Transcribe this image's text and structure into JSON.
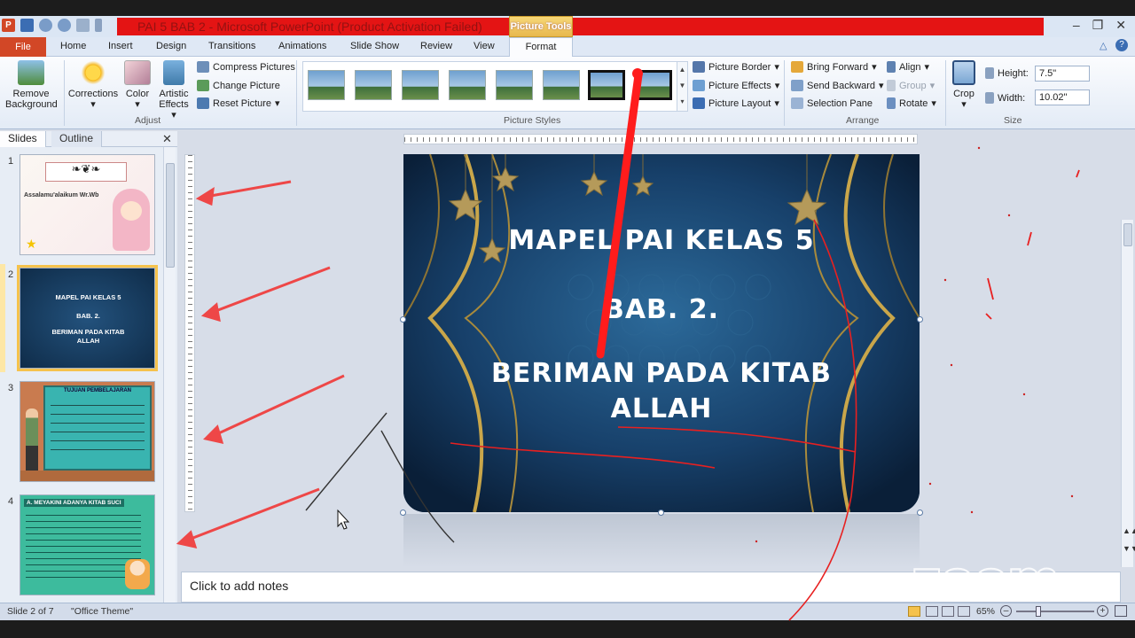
{
  "window": {
    "title": "PAI 5 BAB 2 - Microsoft PowerPoint (Product Activation Failed)",
    "context_tab_group": "Picture Tools",
    "minimize": "–",
    "maximize": "❐",
    "close": "✕"
  },
  "tabs": {
    "file": "File",
    "items": [
      "Home",
      "Insert",
      "Design",
      "Transitions",
      "Animations",
      "Slide Show",
      "Review",
      "View"
    ],
    "format": "Format"
  },
  "ribbon": {
    "remove_background": [
      "Remove",
      "Background"
    ],
    "corrections": "Corrections",
    "color": "Color",
    "artistic_effects": [
      "Artistic",
      "Effects"
    ],
    "compress_pictures": "Compress Pictures",
    "change_picture": "Change Picture",
    "reset_picture": "Reset Picture",
    "group_adjust": "Adjust",
    "group_picture_styles": "Picture Styles",
    "picture_border": "Picture Border",
    "picture_effects": "Picture Effects",
    "picture_layout": "Picture Layout",
    "bring_forward": "Bring Forward",
    "send_backward": "Send Backward",
    "selection_pane": "Selection Pane",
    "align": "Align",
    "group": "Group",
    "rotate": "Rotate",
    "group_arrange": "Arrange",
    "crop": "Crop",
    "height_label": "Height:",
    "height_value": "7.5\"",
    "width_label": "Width:",
    "width_value": "10.02\"",
    "group_size": "Size"
  },
  "panel": {
    "tab_slides": "Slides",
    "tab_outline": "Outline",
    "close": "✕"
  },
  "thumbnails": [
    {
      "num": "1",
      "greeting": "Assalamu'alaikum Wr.Wb"
    },
    {
      "num": "2",
      "line1": "MAPEL PAI KELAS 5",
      "line2": "BAB. 2.",
      "line3": "BERIMAN PADA KITAB",
      "line4": "ALLAH"
    },
    {
      "num": "3",
      "heading": "TUJUAN PEMBELAJARAN"
    },
    {
      "num": "4",
      "heading": "A. MEYAKINI ADANYA KITAB SUCI"
    }
  ],
  "slide": {
    "line1": "MAPEL PAI KELAS 5",
    "line2": "BAB. 2.",
    "line3": "BERIMAN PADA KITAB",
    "line4": "ALLAH"
  },
  "notes_placeholder": "Click to add notes",
  "status": {
    "slide_info": "Slide 2 of 7",
    "theme": "\"Office Theme\"",
    "zoom": "65%"
  },
  "watermark": "zoom",
  "colors": {
    "title_red": "#e41414",
    "file_tab": "#d24726",
    "slide_bg": "#14385d",
    "annotation": "#ef2b2b"
  }
}
